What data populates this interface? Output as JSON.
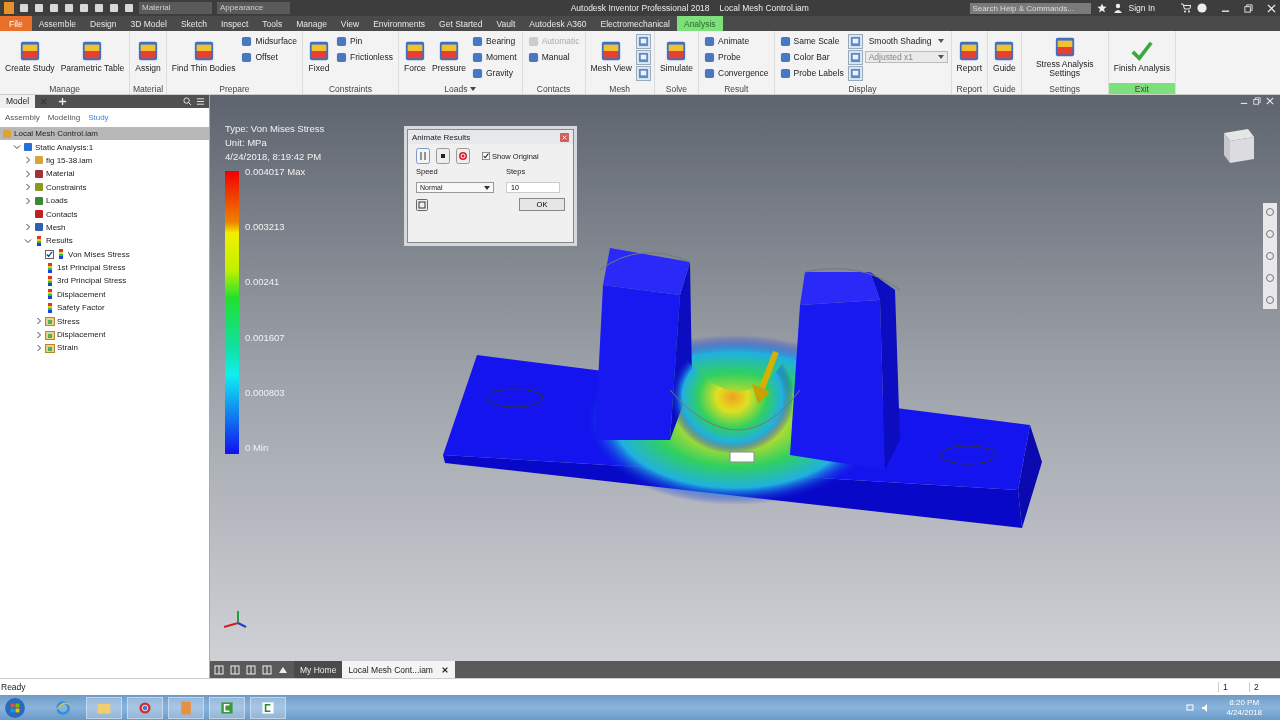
{
  "title_bar": {
    "app": "Autodesk Inventor Professional 2018",
    "document": "Local Mesh Control.iam",
    "material": "Material",
    "appearance": "Appearance",
    "search": {
      "placeholder": "Search Help & Commands..."
    },
    "sign_in": "Sign In"
  },
  "menu_tabs": [
    {
      "label": "File",
      "kind": "file",
      "selected": false
    },
    {
      "label": "Assemble",
      "kind": "tab",
      "selected": false
    },
    {
      "label": "Design",
      "kind": "tab",
      "selected": false
    },
    {
      "label": "3D Model",
      "kind": "tab",
      "selected": false
    },
    {
      "label": "Sketch",
      "kind": "tab",
      "selected": false
    },
    {
      "label": "Inspect",
      "kind": "tab",
      "selected": false
    },
    {
      "label": "Tools",
      "kind": "tab",
      "selected": false
    },
    {
      "label": "Manage",
      "kind": "tab",
      "selected": false
    },
    {
      "label": "View",
      "kind": "tab",
      "selected": false
    },
    {
      "label": "Environments",
      "kind": "tab",
      "selected": false
    },
    {
      "label": "Get Started",
      "kind": "tab",
      "selected": false
    },
    {
      "label": "Vault",
      "kind": "tab",
      "selected": false
    },
    {
      "label": "Autodesk A360",
      "kind": "tab",
      "selected": false
    },
    {
      "label": "Electromechanical",
      "kind": "tab",
      "selected": false
    },
    {
      "label": "Analysis",
      "kind": "tab",
      "selected": true
    }
  ],
  "ribbon": [
    {
      "label": "Manage",
      "highlighted": false,
      "items": [
        {
          "label": "Create Study",
          "kind": "large",
          "disabled": false
        },
        {
          "label": "Parametric Table",
          "kind": "large",
          "disabled": false
        }
      ]
    },
    {
      "label": "Material",
      "highlighted": false,
      "items": [
        {
          "label": "Assign",
          "kind": "large",
          "disabled": false
        }
      ]
    },
    {
      "label": "Prepare",
      "highlighted": false,
      "items": [
        {
          "label": "Find Thin Bodies",
          "kind": "large",
          "disabled": false
        },
        {
          "label": "Midsurface",
          "kind": "small",
          "disabled": false
        },
        {
          "label": "Offset",
          "kind": "small",
          "disabled": false
        }
      ]
    },
    {
      "label": "Constraints",
      "highlighted": false,
      "items": [
        {
          "label": "Fixed",
          "kind": "large",
          "disabled": false
        },
        {
          "label": "Pin",
          "kind": "small",
          "disabled": false
        },
        {
          "label": "Frictionless",
          "kind": "small",
          "disabled": false
        }
      ]
    },
    {
      "label": "Loads",
      "highlighted": false,
      "has_menu": true,
      "items": [
        {
          "label": "Force",
          "kind": "large",
          "disabled": false
        },
        {
          "label": "Pressure",
          "kind": "large",
          "disabled": false
        },
        {
          "label": "Bearing",
          "kind": "small",
          "disabled": false
        },
        {
          "label": "Moment",
          "kind": "small",
          "disabled": false
        },
        {
          "label": "Gravity",
          "kind": "small",
          "disabled": false
        }
      ]
    },
    {
      "label": "Contacts",
      "highlighted": false,
      "items": [
        {
          "label": "Automatic",
          "kind": "small",
          "disabled": true
        },
        {
          "label": "Manual",
          "kind": "small",
          "disabled": false
        }
      ]
    },
    {
      "label": "Mesh",
      "highlighted": false,
      "items": [
        {
          "label": "Mesh View",
          "kind": "large",
          "disabled": false
        },
        {
          "kind": "icon",
          "disabled": false
        },
        {
          "kind": "icon",
          "disabled": false
        },
        {
          "kind": "icon",
          "disabled": false
        }
      ]
    },
    {
      "label": "Solve",
      "highlighted": false,
      "items": [
        {
          "label": "Simulate",
          "kind": "large",
          "disabled": false
        }
      ]
    },
    {
      "label": "Result",
      "highlighted": false,
      "items": [
        {
          "label": "Animate",
          "kind": "small",
          "disabled": false
        },
        {
          "label": "Probe",
          "kind": "small",
          "disabled": false
        },
        {
          "label": "Convergence",
          "kind": "small",
          "disabled": false
        }
      ]
    },
    {
      "label": "Display",
      "highlighted": false,
      "items": [
        {
          "label": "Same Scale",
          "kind": "small",
          "disabled": false
        },
        {
          "label": "Color Bar",
          "kind": "small",
          "disabled": false
        },
        {
          "label": "Probe Labels",
          "kind": "small",
          "disabled": false
        },
        {
          "kind": "icon",
          "disabled": false
        },
        {
          "kind": "icon",
          "disabled": false
        },
        {
          "kind": "icon",
          "disabled": false
        },
        {
          "label": "Smooth Shading",
          "kind": "dropdown",
          "disabled": false
        },
        {
          "label": "Adjusted x1",
          "kind": "dropdown",
          "disabled": true
        }
      ]
    },
    {
      "label": "Report",
      "highlighted": false,
      "items": [
        {
          "label": "Report",
          "kind": "large",
          "disabled": false
        }
      ]
    },
    {
      "label": "Guide",
      "highlighted": false,
      "items": [
        {
          "label": "Guide",
          "kind": "large",
          "disabled": false
        }
      ]
    },
    {
      "label": "Settings",
      "highlighted": false,
      "items": [
        {
          "label": "Stress Analysis Settings",
          "kind": "large",
          "disabled": false
        }
      ]
    },
    {
      "label": "Exit",
      "highlighted": true,
      "items": [
        {
          "label": "Finish Analysis",
          "kind": "finish",
          "disabled": false
        }
      ]
    }
  ],
  "browser": {
    "tab": "Model",
    "views": [
      {
        "label": "Assembly",
        "selected": false
      },
      {
        "label": "Modeling",
        "selected": false
      },
      {
        "label": "Study",
        "selected": true
      }
    ],
    "tree": [
      {
        "label": "Local Mesh Control.iam",
        "kind": "assembly",
        "selected": true,
        "children": [
          {
            "label": "Static Analysis:1",
            "kind": "analysis",
            "selected": false,
            "expanded": true,
            "children": [
              {
                "label": "fig 15-38.iam",
                "kind": "assembly",
                "selected": false,
                "expanded": false
              },
              {
                "label": "Material",
                "kind": "material",
                "selected": false,
                "expanded": false
              },
              {
                "label": "Constraints",
                "kind": "constraints",
                "selected": false,
                "expanded": false
              },
              {
                "label": "Loads",
                "kind": "loads",
                "selected": false,
                "expanded": false
              },
              {
                "label": "Contacts",
                "kind": "contacts",
                "selected": false
              },
              {
                "label": "Mesh",
                "kind": "mesh",
                "selected": false,
                "expanded": false
              },
              {
                "label": "Results",
                "kind": "results",
                "selected": false,
                "expanded": true,
                "children": [
                  {
                    "label": "Von Mises Stress",
                    "kind": "result",
                    "selected": false,
                    "checked": true
                  },
                  {
                    "label": "1st Principal Stress",
                    "kind": "result",
                    "selected": false,
                    "checked": false
                  },
                  {
                    "label": "3rd Principal Stress",
                    "kind": "result",
                    "selected": false,
                    "checked": false
                  },
                  {
                    "label": "Displacement",
                    "kind": "result",
                    "selected": false,
                    "checked": false
                  },
                  {
                    "label": "Safety Factor",
                    "kind": "result",
                    "selected": false,
                    "checked": false
                  },
                  {
                    "label": "Stress",
                    "kind": "folder",
                    "selected": false,
                    "expanded": false
                  },
                  {
                    "label": "Displacement",
                    "kind": "folder",
                    "selected": false,
                    "expanded": false
                  },
                  {
                    "label": "Strain",
                    "kind": "folder",
                    "selected": false,
                    "expanded": false
                  }
                ]
              }
            ]
          }
        ]
      }
    ]
  },
  "legend": {
    "type": "Type: Von Mises Stress",
    "unit": "Unit: MPa",
    "date": "4/24/2018, 8:19:42 PM",
    "labels": [
      "0.004017 Max",
      "0.003213",
      "0.00241",
      "0.001607",
      "0.000803",
      "0 Min"
    ]
  },
  "dialog": {
    "title": "Animate Results",
    "show_original": {
      "label": "Show Original",
      "checked": true
    },
    "speed": {
      "label": "Speed",
      "value": "Normal"
    },
    "steps": {
      "label": "Steps",
      "value": "10"
    },
    "ok": "OK"
  },
  "doc_tabs": [
    {
      "label": "My Home",
      "selected": false
    },
    {
      "label": "Local Mesh Cont...iam",
      "selected": true
    }
  ],
  "status_bar": {
    "text": "Ready",
    "pages": [
      "1",
      "2"
    ]
  },
  "taskbar": {
    "time": "8:20 PM",
    "date": "4/24/2018"
  }
}
